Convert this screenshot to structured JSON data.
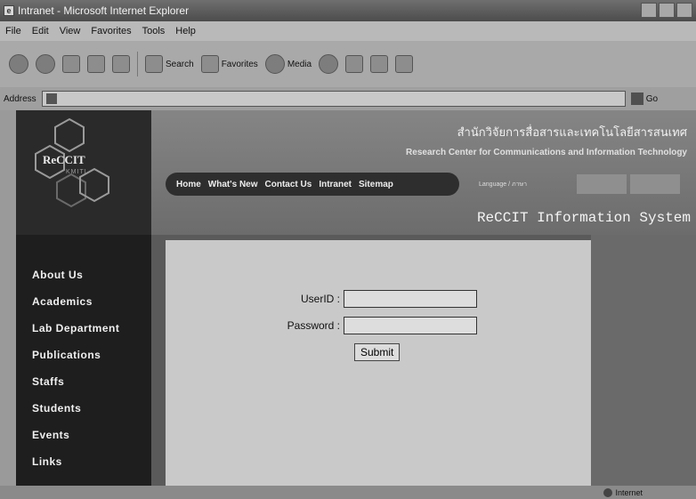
{
  "window": {
    "title": "Intranet - Microsoft Internet Explorer"
  },
  "menu": [
    "File",
    "Edit",
    "View",
    "Favorites",
    "Tools",
    "Help"
  ],
  "toolbar": {
    "search_label": "Search",
    "favorites_label": "Favorites",
    "media_label": "Media"
  },
  "address": {
    "label": "Address",
    "go_label": "Go"
  },
  "site": {
    "logo_text": "ReCCIT",
    "logo_sub": "KMITL",
    "thai_title": "สำนักวิจัยการสื่อสารและเทคโนโลยีสารสนเทศ",
    "english_title": "Research Center for Communications and Information Technology",
    "nav": [
      "Home",
      "What's New",
      "Contact Us",
      "Intranet",
      "Sitemap"
    ],
    "language_label": "Language / ภาษา",
    "system_title": "ReCCIT Information System",
    "sidebar": [
      "About Us",
      "Academics",
      "Lab Department",
      "Publications",
      "Staffs",
      "Students",
      "Events",
      "Links"
    ]
  },
  "login": {
    "user_label": "UserID :",
    "password_label": "Password :",
    "user_value": "",
    "password_value": "",
    "submit_label": "Submit"
  },
  "status": {
    "zone": "Internet"
  }
}
